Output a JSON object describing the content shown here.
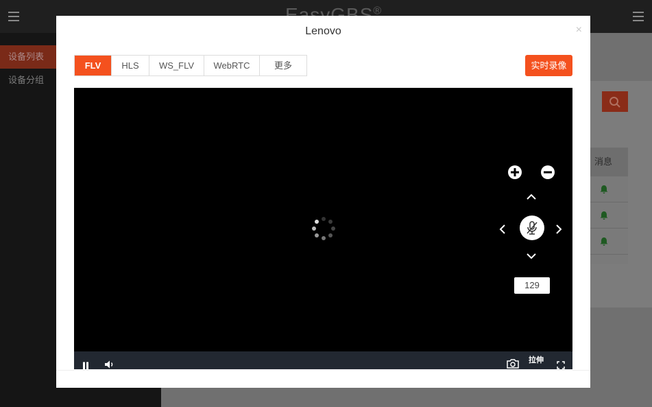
{
  "app": {
    "title": "EasyGBS",
    "title_mark": "®"
  },
  "sidebar": {
    "items": [
      {
        "label": "设备列表",
        "active": true
      },
      {
        "label": "设备分组",
        "active": false
      }
    ]
  },
  "background_table": {
    "header": "消息"
  },
  "modal": {
    "title": "Lenovo",
    "close_label": "×",
    "tabs": [
      {
        "label": "FLV",
        "active": true
      },
      {
        "label": "HLS",
        "active": false
      },
      {
        "label": "WS_FLV",
        "active": false
      },
      {
        "label": "WebRTC",
        "active": false
      },
      {
        "label": "更多",
        "active": false
      }
    ],
    "record_button": "实时录像",
    "ptz": {
      "speed_value": "129",
      "icons": [
        "zoom-in-icon",
        "zoom-out-icon",
        "chevron-up-icon",
        "chevron-left-icon",
        "microphone-muted-icon",
        "chevron-right-icon",
        "chevron-down-icon"
      ]
    },
    "controls": {
      "stretch_label": "拉伸",
      "icons": [
        "pause-icon",
        "volume-icon",
        "camera-icon",
        "fullscreen-icon"
      ]
    }
  },
  "colors": {
    "accent": "#f4511e",
    "player_bg": "#000000",
    "controlbar_bg": "#222831",
    "bell_green": "#2e7d32"
  }
}
